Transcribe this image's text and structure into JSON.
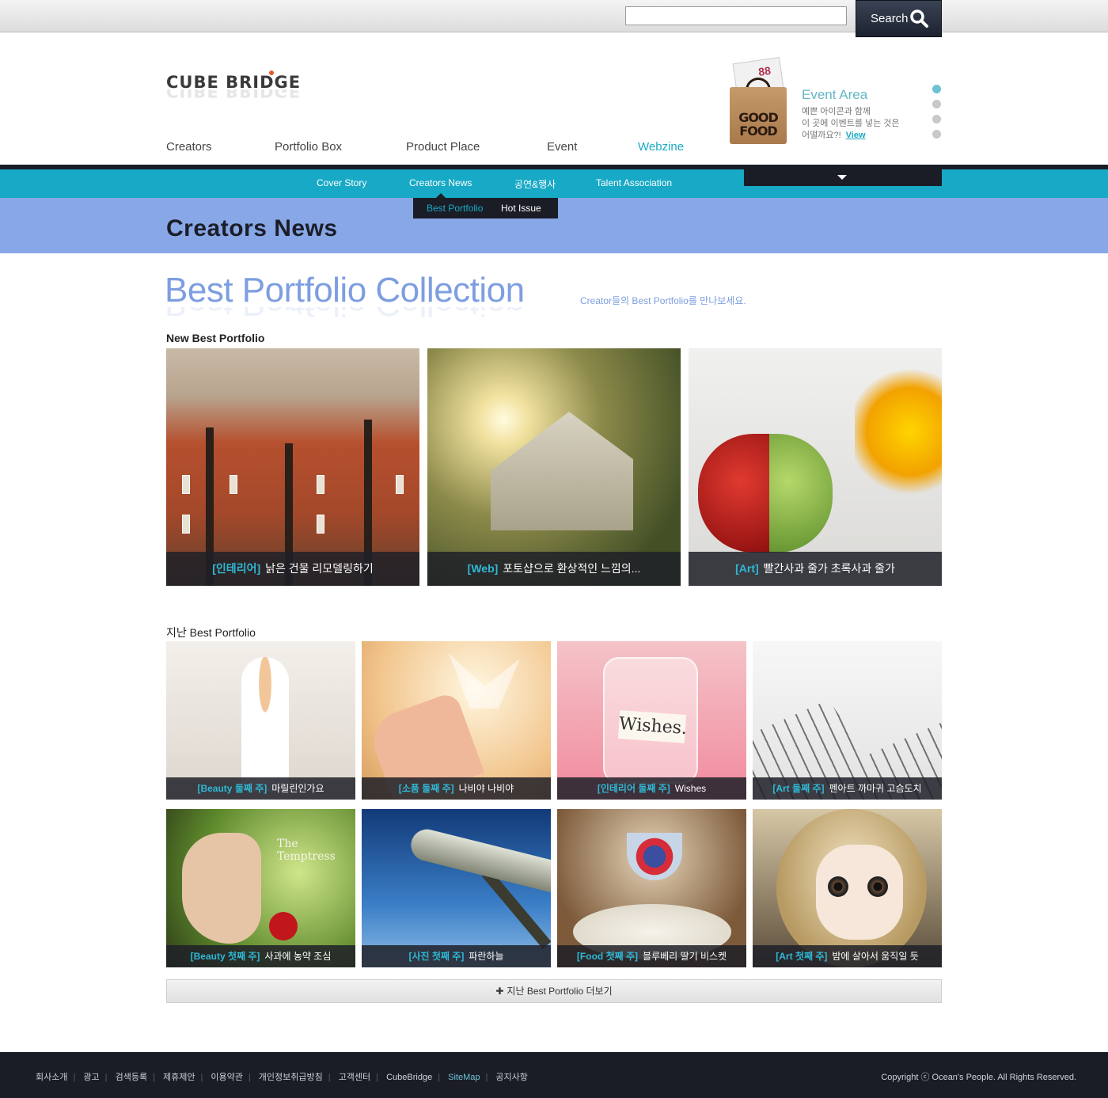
{
  "search": {
    "placeholder": "",
    "button_label": "Search"
  },
  "logo": {
    "text": "CUBE BRIDGE"
  },
  "main_nav": [
    {
      "label": "Creators",
      "active": false
    },
    {
      "label": "Portfolio Box",
      "active": false
    },
    {
      "label": "Product Place",
      "active": false
    },
    {
      "label": "Event",
      "active": false
    },
    {
      "label": "Webzine",
      "active": true
    }
  ],
  "event_area": {
    "bag_text": "GOOD FOOD",
    "title": "Event Area",
    "desc_line1": "예쁜 아이콘과 함께",
    "desc_line2": "이 곳에 이벤트를 넣는 것은",
    "desc_line3": "어떨까요?!",
    "view_label": "View",
    "slides": 4,
    "active_slide": 1
  },
  "sub_nav": [
    "Cover Story",
    "Creators News",
    "공연&행사",
    "Talent Association"
  ],
  "dropdown": [
    {
      "label": "Best Portfolio",
      "active": true
    },
    {
      "label": "Hot Issue",
      "active": false
    }
  ],
  "page_title": "Creators News",
  "heading": {
    "title": "Best Portfolio Collection",
    "subtitle": "Creator들의 Best Portfolio를 만나보세요."
  },
  "new_section": {
    "label": "New Best Portfolio",
    "items": [
      {
        "tag": "[인테리어]",
        "text": "낡은 건물 리모델링하기"
      },
      {
        "tag": "[Web]",
        "text": "포토샵으로 환상적인 느낌의..."
      },
      {
        "tag": "[Art]",
        "text": "빨간사과 줄가 초록사과 줄가"
      }
    ]
  },
  "past_section": {
    "label": "지난 Best Portfolio",
    "items": [
      {
        "tag": "[Beauty 둘째 주]",
        "text": "마릴린인가요"
      },
      {
        "tag": "[소품 둘째 주]",
        "text": "나비야 나비야"
      },
      {
        "tag": "[인테리어 둘째 주]",
        "text": "Wishes"
      },
      {
        "tag": "[Art 둘째 주]",
        "text": "펜아트 까마귀 고슴도치"
      },
      {
        "tag": "[Beauty 첫째 주]",
        "text": "사과에 농약 조심"
      },
      {
        "tag": "[사진 첫째 주]",
        "text": "파란하늘"
      },
      {
        "tag": "[Food 첫째 주]",
        "text": "블루베리 딸기 비스켓"
      },
      {
        "tag": "[Art 첫째 주]",
        "text": "밤에 살아서 움직일 듯"
      }
    ],
    "art_text": {
      "wishes": "Wishes.",
      "temptress": "The Temptress"
    }
  },
  "more_label": "지난 Best Portfolio 더보기",
  "footer": {
    "links": [
      "회사소개",
      "광고",
      "검색등록",
      "제휴제안",
      "이용약관",
      "개인정보취급방침",
      "고객센터",
      "CubeBridge",
      "SiteMap",
      "공지사항"
    ],
    "highlight": "SiteMap",
    "copyright": "Copyright ⓒ Ocean's People. All Rights Reserved."
  },
  "colors": {
    "accent": "#17a9c5",
    "band": "#88a7e6",
    "dark": "#1a1d26",
    "heading": "#7d9ee0"
  }
}
